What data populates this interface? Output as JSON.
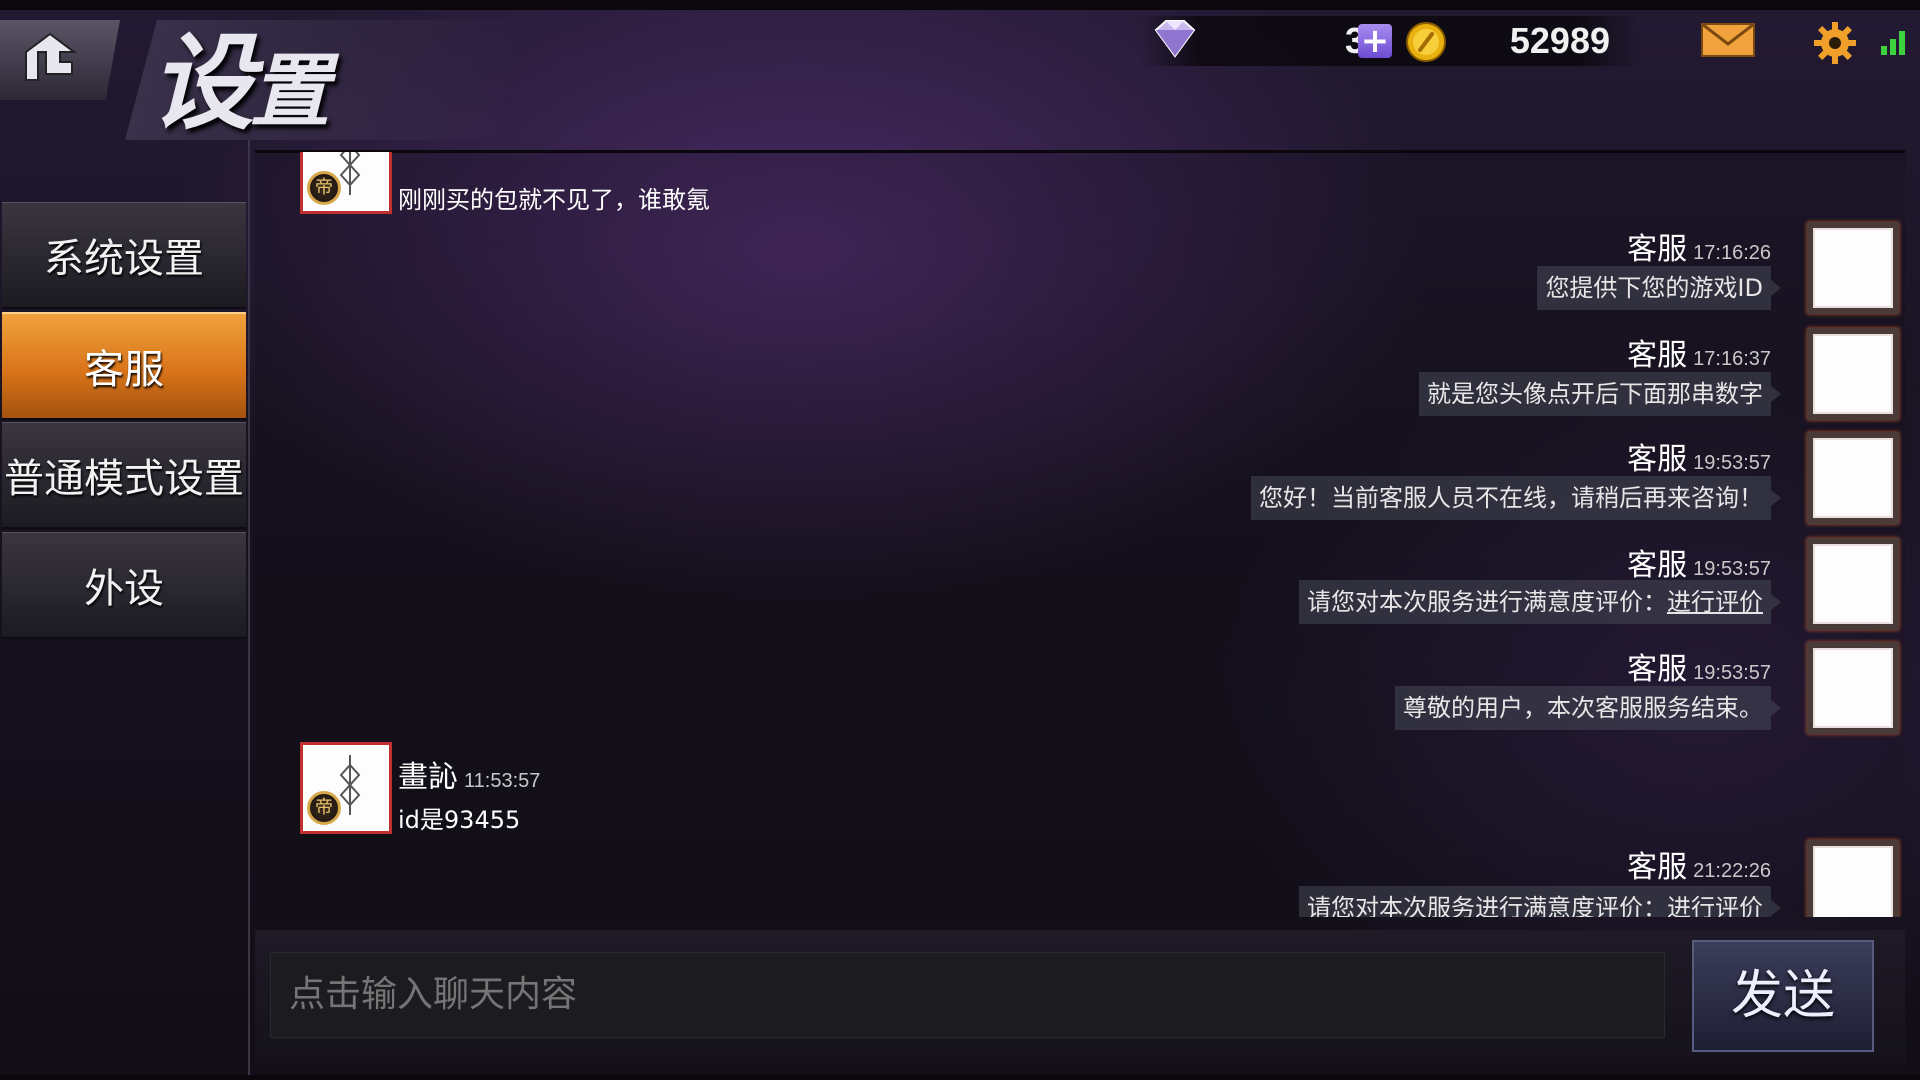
{
  "header": {
    "title_big": "设",
    "title_small": "置",
    "gems": "32",
    "coins": "52989",
    "plus_label": "+"
  },
  "sidebar": {
    "items": [
      {
        "label": "系统设置"
      },
      {
        "label": "客服"
      },
      {
        "label": "普通模式设置"
      },
      {
        "label": "外设"
      }
    ]
  },
  "chat": {
    "messages": [
      {
        "side": "left",
        "text": "刚刚买的包就不见了，谁敢氪"
      },
      {
        "side": "right",
        "sender": "客服",
        "time": "17:16:26",
        "text": "您提供下您的游戏ID"
      },
      {
        "side": "right",
        "sender": "客服",
        "time": "17:16:37",
        "text": "就是您头像点开后下面那串数字"
      },
      {
        "side": "right",
        "sender": "客服",
        "time": "19:53:57",
        "text": "您好！当前客服人员不在线，请稍后再来咨询！"
      },
      {
        "side": "right",
        "sender": "客服",
        "time": "19:53:57",
        "text": "请您对本次服务进行满意度评价：",
        "link": "进行评价"
      },
      {
        "side": "right",
        "sender": "客服",
        "time": "19:53:57",
        "text": "尊敬的用户，本次客服服务结束。"
      },
      {
        "side": "left",
        "sender": "畫訫",
        "time": "11:53:57",
        "text": "id是93455"
      },
      {
        "side": "right",
        "sender": "客服",
        "time": "21:22:26",
        "text": "请您对本次服务进行满意度评价：",
        "link": "进行评价"
      }
    ]
  },
  "input": {
    "placeholder": "点击输入聊天内容",
    "send_label": "发送"
  },
  "icons": {
    "back": "back-arrow-icon",
    "gem": "diamond-icon",
    "coin": "coin-icon",
    "mail": "mail-icon",
    "gear": "gear-icon",
    "signal": "signal-icon"
  },
  "colors": {
    "active_tab": "#e08a28",
    "badge_gold": "#d6a84a",
    "avatar_border": "#c0302e"
  }
}
